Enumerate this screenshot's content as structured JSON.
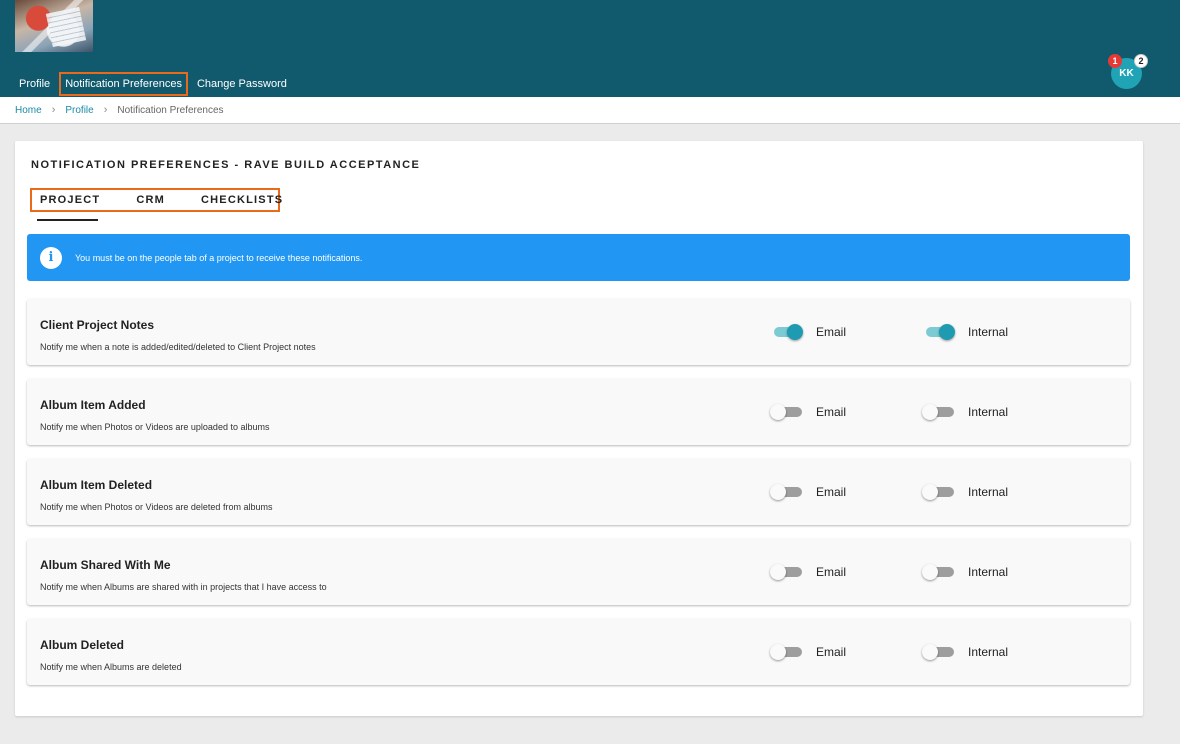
{
  "nav": {
    "items": [
      {
        "label": "Profile",
        "active": false
      },
      {
        "label": "Notification Preferences",
        "active": true
      },
      {
        "label": "Change Password",
        "active": false
      }
    ]
  },
  "user": {
    "initials": "KK",
    "badge_red": "1",
    "badge_white": "2"
  },
  "breadcrumb": {
    "home": "Home",
    "profile": "Profile",
    "current": "Notification Preferences",
    "separator": "›"
  },
  "card": {
    "title": "NOTIFICATION PREFERENCES - RAVE BUILD ACCEPTANCE",
    "tabs": [
      "PROJECT",
      "CRM",
      "CHECKLISTS"
    ],
    "active_tab": "PROJECT"
  },
  "info": {
    "icon": "i",
    "text": "You must be on the people tab of a project to receive these notifications."
  },
  "labels": {
    "email": "Email",
    "internal": "Internal"
  },
  "rows": [
    {
      "title": "Client Project Notes",
      "description": "Notify me when a note is added/edited/deleted to Client Project notes",
      "email": true,
      "internal": true
    },
    {
      "title": "Album Item Added",
      "description": "Notify me when Photos or Videos are uploaded to albums",
      "email": false,
      "internal": false
    },
    {
      "title": "Album Item Deleted",
      "description": "Notify me when Photos or Videos are deleted from albums",
      "email": false,
      "internal": false
    },
    {
      "title": "Album Shared With Me",
      "description": "Notify me when Albums are shared with in projects that I have access to",
      "email": false,
      "internal": false
    },
    {
      "title": "Album Deleted",
      "description": "Notify me when Albums are deleted",
      "email": false,
      "internal": false
    }
  ],
  "colors": {
    "header": "#115a6e",
    "accent": "#1e9bb0",
    "info": "#2196f3",
    "highlight": "#e86a1a"
  }
}
